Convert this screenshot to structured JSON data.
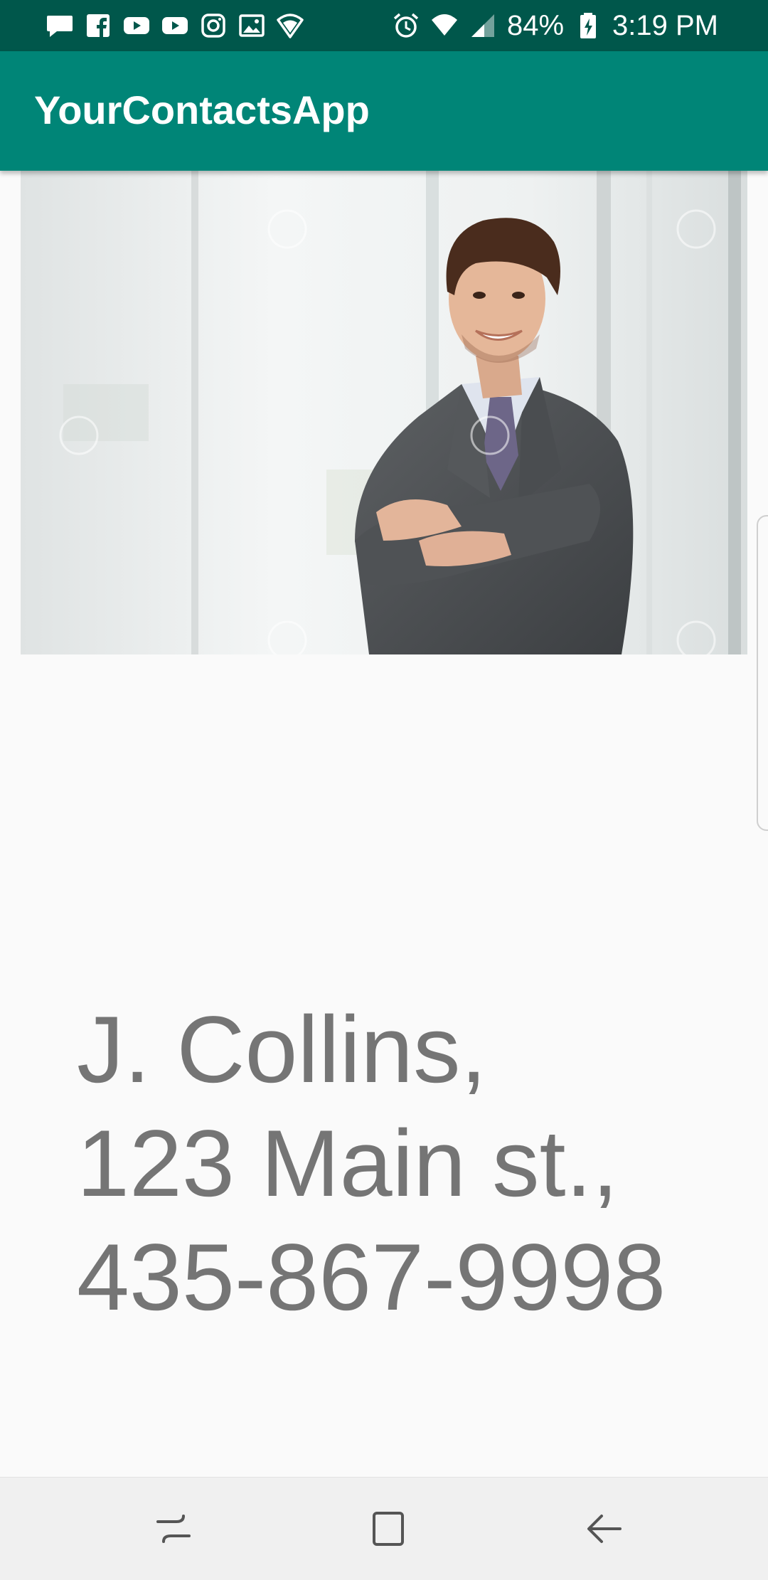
{
  "status_bar": {
    "left_icons": [
      "message-icon",
      "facebook-icon",
      "youtube-icon",
      "youtube-icon",
      "instagram-icon",
      "gallery-icon",
      "wifi-shield-icon"
    ],
    "battery_percent": "84%",
    "time": "3:19 PM",
    "right_icons": [
      "alarm-icon",
      "wifi-icon",
      "signal-icon",
      "battery-charging-icon"
    ]
  },
  "app_bar": {
    "title": "YourContactsApp"
  },
  "contact": {
    "name": "J. Collins,",
    "address": "123 Main st.,",
    "phone": "435-867-9998"
  },
  "nav_bar": {
    "buttons": [
      "recent-apps",
      "home",
      "back"
    ]
  },
  "colors": {
    "status_bar": "#00574b",
    "app_bar": "#008577",
    "contact_text": "#757575",
    "background": "#fafafa"
  }
}
